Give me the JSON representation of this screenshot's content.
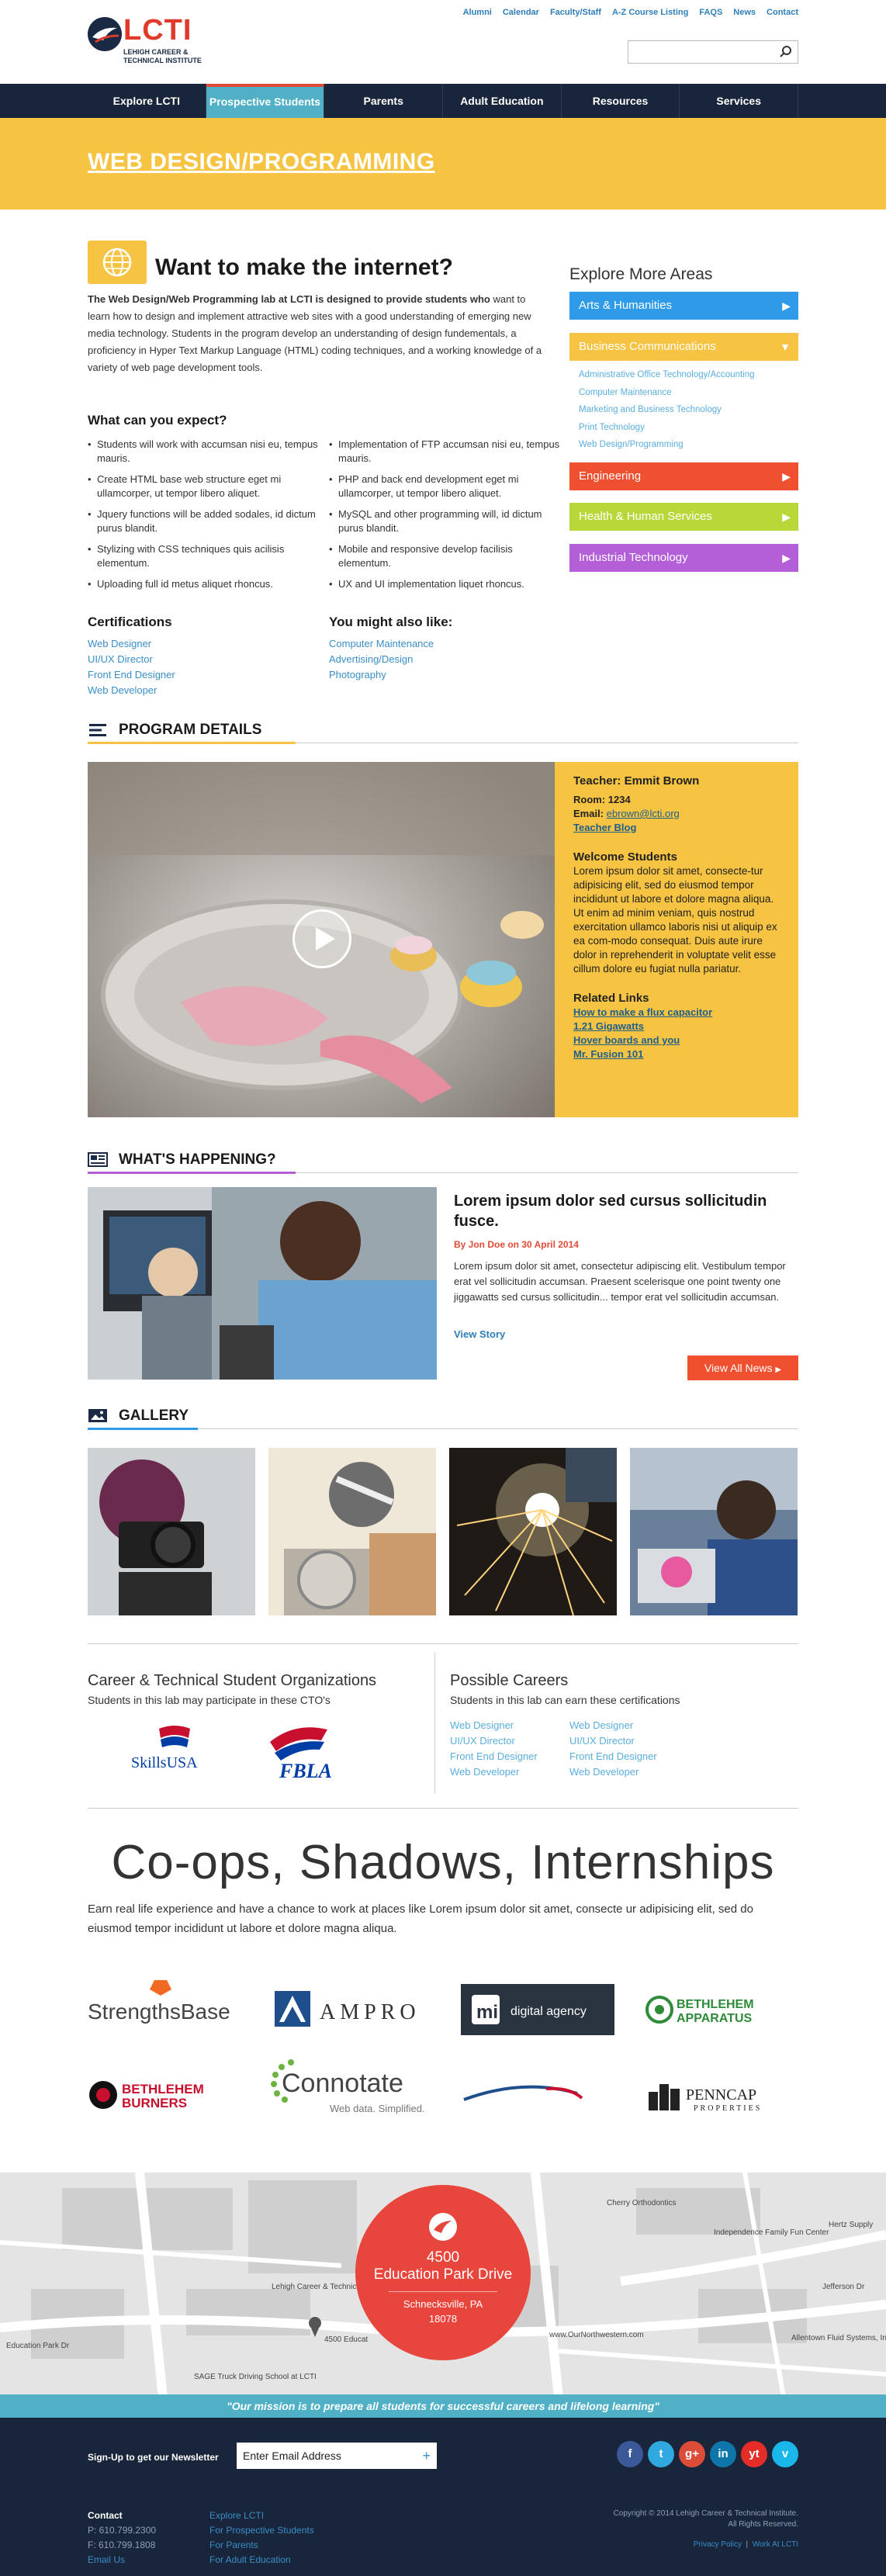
{
  "header": {
    "logo_text": "LCTI",
    "logo_sub": "Lehigh Career & Technical Institute",
    "top_links": [
      "Alumni",
      "Calendar",
      "Faculty/Staff",
      "A-Z Course Listing",
      "FAQS",
      "News",
      "Contact"
    ],
    "search_placeholder": ""
  },
  "nav": {
    "items": [
      "Explore LCTI",
      "Prospective Students",
      "Parents",
      "Adult Education",
      "Resources",
      "Services"
    ],
    "active": "Prospective Students"
  },
  "banner": {
    "title": "WEB DESIGN/PROGRAMMING"
  },
  "intro": {
    "title": "Want to make the internet?",
    "lead": "The Web Design/Web Programming lab at LCTI is designed to provide students who",
    "body": "want to learn how to design and implement attractive web sites with a good understanding of emerging new media technology. Students in the program develop an understanding of design fundementals, a proficiency in Hyper Text Markup Language (HTML) coding techniques, and a working knowledge of a variety of web page development tools."
  },
  "expect": {
    "title": "What can you expect?",
    "left": [
      "Students will work with accumsan nisi eu, tempus mauris.",
      "Create HTML base web structure eget mi ullamcorper, ut tempor libero aliquet.",
      "Jquery functions will be added sodales, id dictum purus blandit.",
      "Stylizing with CSS techniques quis acilisis elementum.",
      "Uploading full id metus aliquet rhoncus."
    ],
    "right": [
      "Implementation of FTP accumsan nisi eu, tempus mauris.",
      "PHP and back end development eget mi ullamcorper, ut tempor libero aliquet.",
      "MySQL and other programming will, id dictum purus blandit.",
      "Mobile and responsive develop facilisis elementum.",
      "UX and UI implementation liquet rhoncus."
    ]
  },
  "certifications": {
    "title": "Certifications",
    "items": [
      "Web Designer",
      "UI/UX Director",
      "Front End Designer",
      "Web Developer"
    ]
  },
  "also_like": {
    "title": "You might also like:",
    "items": [
      "Computer Maintenance",
      "Advertising/Design",
      "Photography"
    ]
  },
  "sidebar": {
    "title": "Explore More Areas",
    "areas": [
      {
        "label": "Arts & Humanities",
        "color": "#2f9be8"
      },
      {
        "label": "Business Communications",
        "color": "#f6c342"
      },
      {
        "label": "Engineering",
        "color": "#ef5030"
      },
      {
        "label": "Health & Human Services",
        "color": "#b8d83a"
      },
      {
        "label": "Industrial Technology",
        "color": "#b45fd8"
      }
    ],
    "sub_items": [
      "Administrative Office Technology/Accounting",
      "Computer Maintenance",
      "Marketing and Business Technology",
      "Print Technology",
      "Web Design/Programming"
    ]
  },
  "program": {
    "heading": "PROGRAM DETAILS",
    "teacher_label": "Teacher: Emmit Brown",
    "room": "Room: 1234",
    "email_label": "Email:",
    "email": "ebrown@lcti.org",
    "blog": "Teacher Blog",
    "welcome_title": "Welcome Students",
    "welcome_body": "Lorem ipsum dolor sit amet, consecte-tur adipisicing elit, sed do eiusmod tempor incididunt ut labore et dolore magna aliqua. Ut enim ad minim veniam, quis nostrud exercitation ullamco laboris nisi ut aliquip ex ea com-modo consequat. Duis aute irure dolor in reprehenderit in voluptate velit esse cillum dolore eu fugiat nulla pariatur.",
    "related_title": "Related Links",
    "related": [
      "How to make a flux capacitor",
      "1.21 Gigawatts",
      "Hover boards and you",
      "Mr. Fusion 101"
    ]
  },
  "news": {
    "heading": "WHAT'S HAPPENING?",
    "title": "Lorem ipsum dolor sed cursus sollicitudin fusce.",
    "byline": "By Jon Doe on 30 April 2014",
    "body": "Lorem ipsum dolor sit amet, consectetur adipiscing elit. Vestibulum tempor erat vel sollicitudin accumsan. Praesent scelerisque one point twenty one jiggawatts sed cursus sollicitudin... tempor erat vel sollicitudin accumsan.",
    "more": "View Story",
    "all_button": "View All News"
  },
  "gallery": {
    "heading": "GALLERY"
  },
  "orgs": {
    "title": "Career & Technical Student Organizations",
    "sub": "Students in this lab may participate in these CTO's",
    "logos": [
      "SkillsUSA",
      "FBLA"
    ]
  },
  "careers": {
    "title": "Possible Careers",
    "sub": "Students in this lab can earn these certifications",
    "col1": [
      "Web Designer",
      "UI/UX Director",
      "Front End Designer",
      "Web Developer"
    ],
    "col2": [
      "Web Designer",
      "UI/UX Director",
      "Front End Designer",
      "Web Developer"
    ]
  },
  "coops": {
    "title": "Co-ops, Shadows, Internships",
    "body": "Earn real life experience and have a chance to work at places like Lorem ipsum dolor sit amet, consecte ur adipisicing elit, sed do eiusmod tempor incididunt ut labore et dolore magna aliqua.",
    "partners": [
      "StrengthsBase",
      "AMPRO",
      "digital agency",
      "BETHLEHEM APPARATUS",
      "BETHLEHEM BURNERS",
      "Connotate",
      "Web data. Simplified.",
      "PENNCAP PROPERTIES"
    ]
  },
  "map": {
    "labels": [
      "Cherry Orthodontics",
      "Independence Family Fun Center",
      "Hertz Supply",
      "Lehigh Career & Technical Institute",
      "4500 Educat",
      "Education Park Dr",
      "Jefferson Dr",
      "Allentown Fluid Systems, Inc",
      "SAGE Truck Driving School at LCTI",
      "www.OurNorthwestern.com"
    ],
    "address_num": "4500",
    "address_street": "Education Park Drive",
    "city": "Schnecksville, PA",
    "zip": "18078"
  },
  "mission": "\"Our mission is to prepare all students for successful careers and lifelong learning\"",
  "footer": {
    "newsletter_label": "Sign-Up to get our Newsletter",
    "newsletter_placeholder": "Enter Email Address",
    "social": [
      "f",
      "t",
      "g+",
      "in",
      "yt",
      "v"
    ],
    "social_colors": [
      "#3b5998",
      "#2fa9e0",
      "#dd4b39",
      "#0e76a8",
      "#e52d27",
      "#1ab7ea"
    ],
    "contact_title": "Contact",
    "phone": "P: 610.799.2300",
    "fax": "F: 610.799.1808",
    "email_us": "Email Us",
    "links": [
      "Explore LCTI",
      "For Prospective Students",
      "For Parents",
      "For Adult Education"
    ],
    "copyright": "Copyright © 2014 Lehigh Career & Technical Institute.",
    "rights": "All Rights Reserved.",
    "policy": "Privacy Policy",
    "work": "Work At LCTI"
  }
}
